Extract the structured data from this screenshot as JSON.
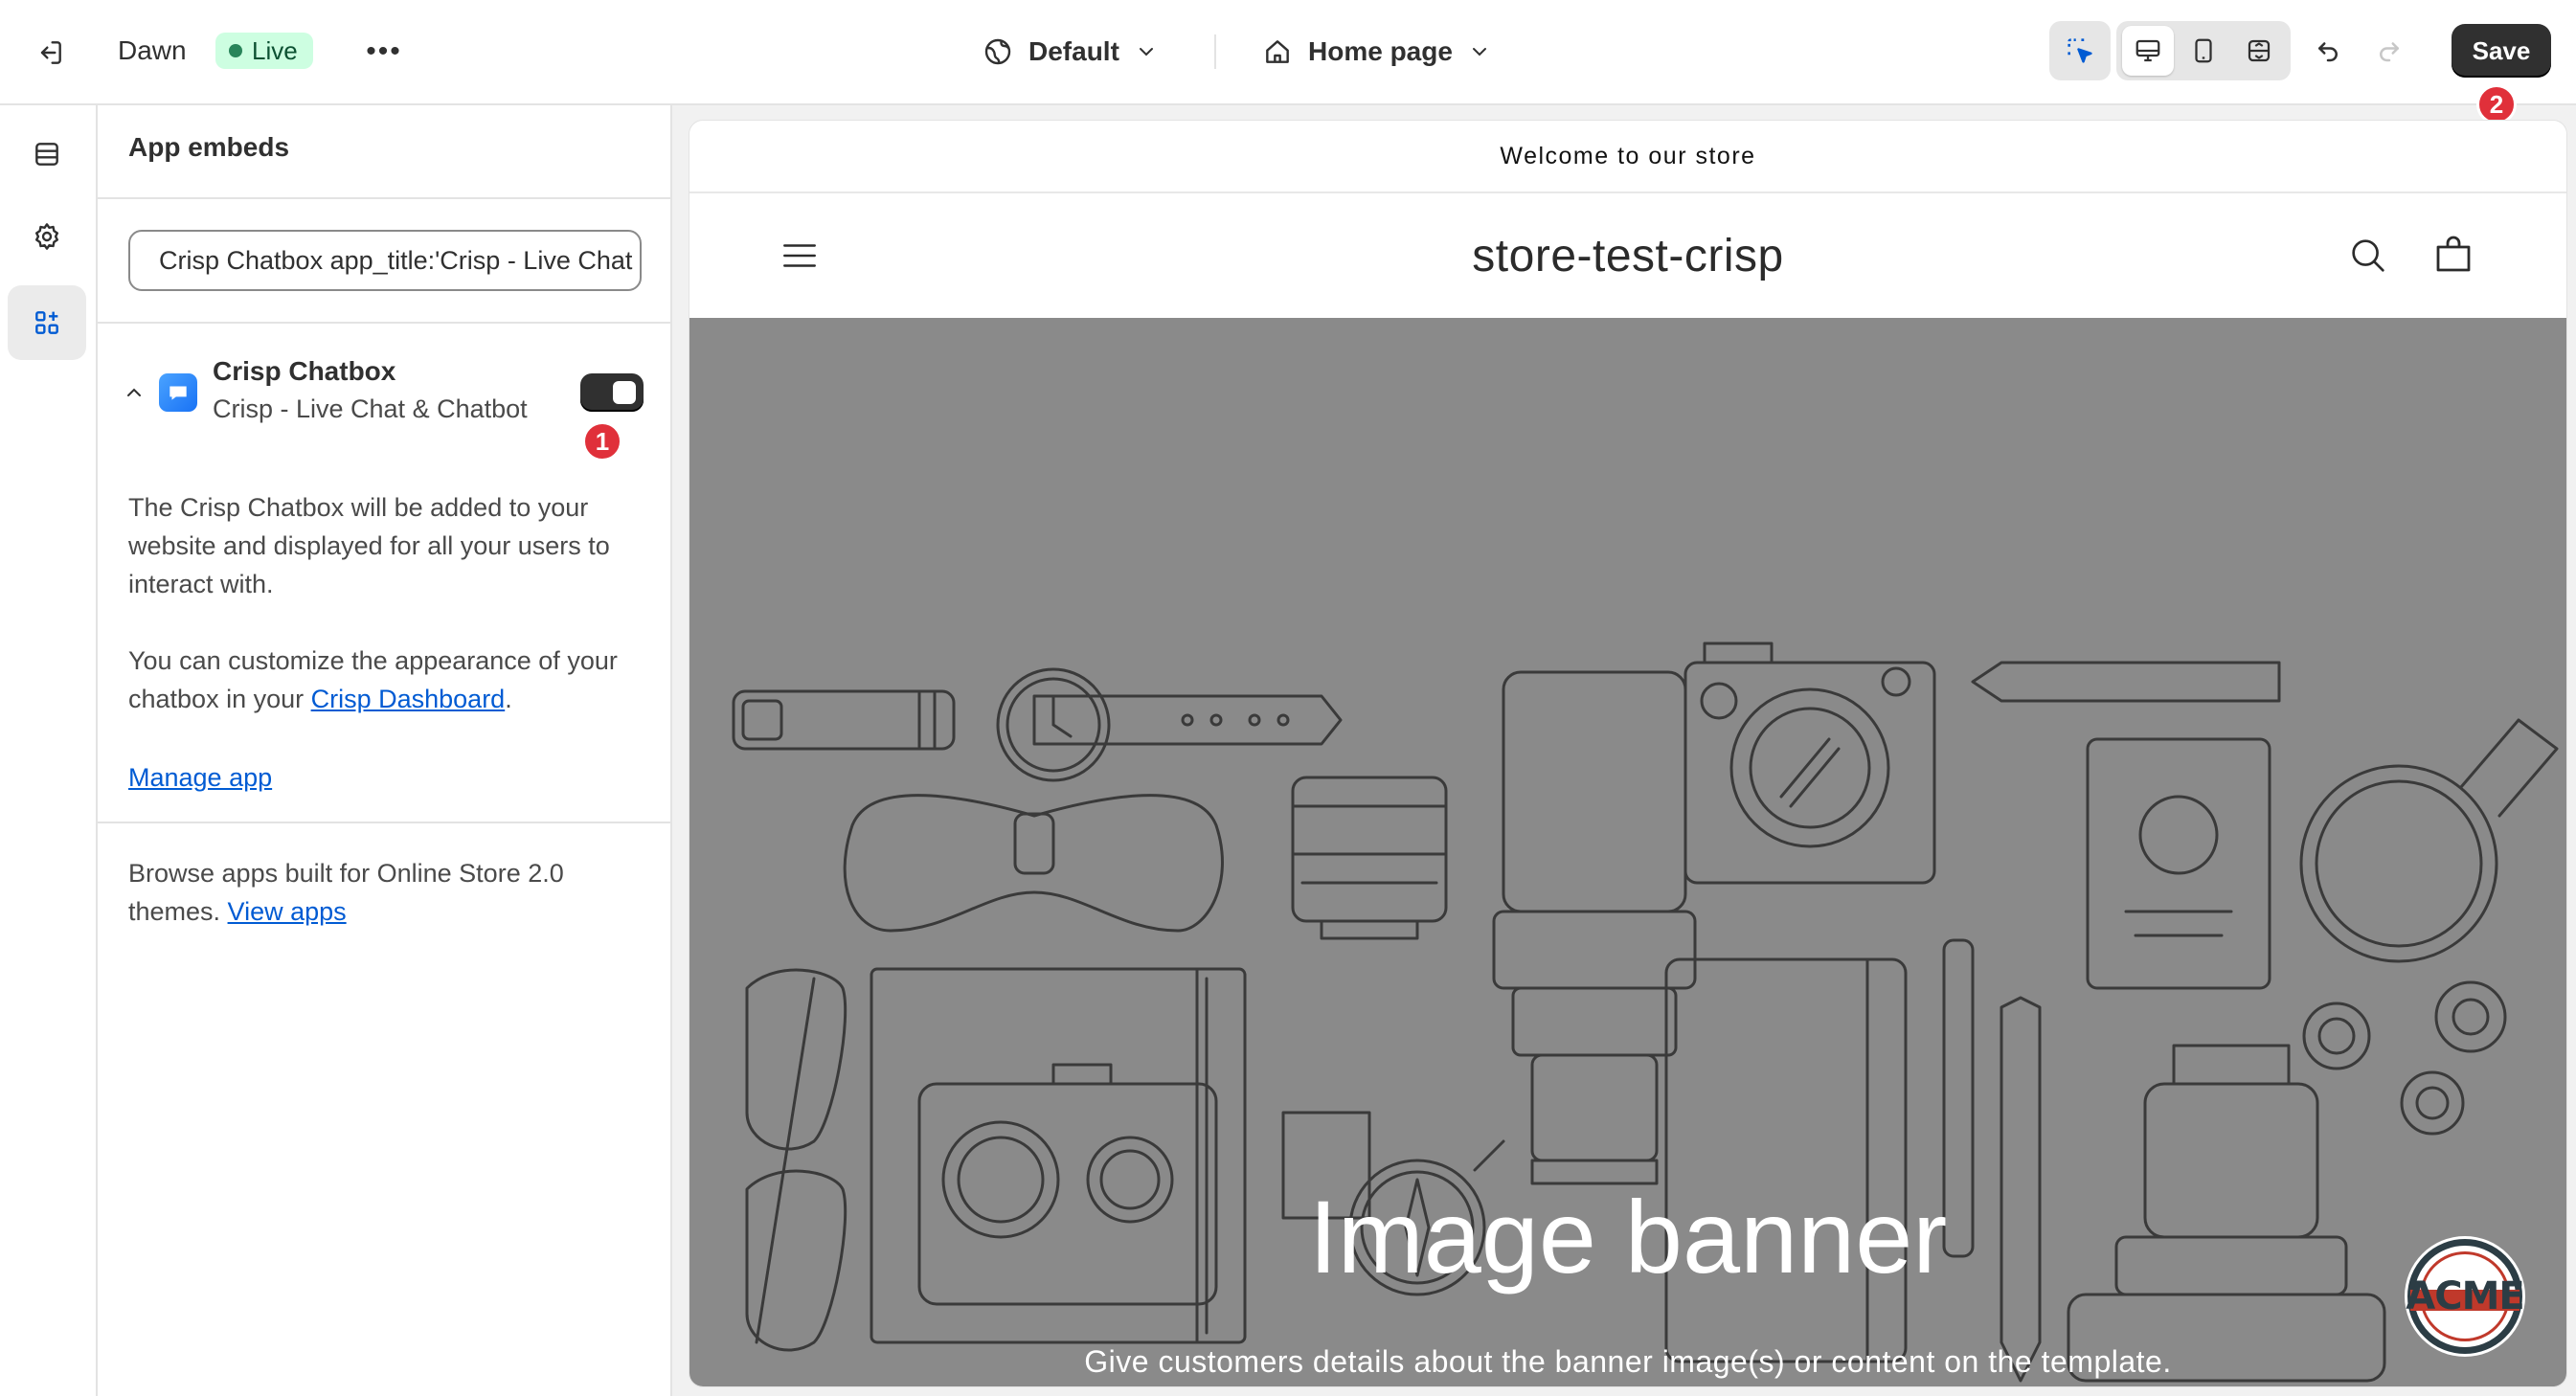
{
  "topbar": {
    "theme_name": "Dawn",
    "live_badge": "Live",
    "more_label": "•••",
    "template_select": "Default",
    "page_select": "Home page",
    "save_label": "Save"
  },
  "annotations": {
    "step_toggle": "1",
    "step_save": "2"
  },
  "sidebar_panel": {
    "title": "App embeds",
    "search_value": "Crisp Chatbox app_title:'Crisp - Live Chat & Chatbot'",
    "app": {
      "name": "Crisp Chatbox",
      "subtitle": "Crisp - Live Chat & Chatbot",
      "enabled": true
    },
    "desc1": "The Crisp Chatbox will be added to your website and displayed for all your users to interact with.",
    "desc2_prefix": "You can customize the appearance of your chatbox in your ",
    "desc2_link": "Crisp Dashboard",
    "desc2_suffix": ".",
    "manage_link": "Manage app",
    "browse_text": "Browse apps built for Online Store 2.0 themes. ",
    "browse_link": "View apps"
  },
  "preview": {
    "announcement": "Welcome to our store",
    "store_name": "store-test-crisp",
    "banner_title": "Image banner",
    "banner_subtitle": "Give customers details about the banner image(s) or content on the template.",
    "acme_logo_text": "ACME"
  },
  "colors": {
    "save_bg": "#303030",
    "live_bg": "#cdfee1",
    "badge_red": "#e0303a",
    "link_blue": "#005bd3",
    "banner_gray": "#8a8a8a"
  }
}
